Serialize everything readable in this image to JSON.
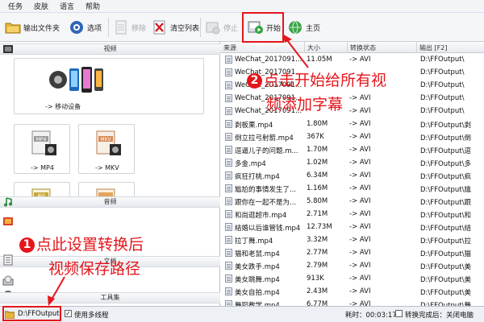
{
  "menu": [
    "任务",
    "皮肤",
    "语言",
    "帮助"
  ],
  "toolbar": {
    "output_folder": "输出文件夹",
    "options": "选项",
    "remove": "移除",
    "clear_list": "清空列表",
    "stop": "停止",
    "start": "开始",
    "home": "主页"
  },
  "left": {
    "video_section": "视频",
    "cards": [
      {
        "label": "-> 移动设备"
      },
      {
        "label": "-> MP4",
        "format": "MP4"
      },
      {
        "label": "-> MKV",
        "format": "MKV"
      },
      {
        "format": "AVI"
      },
      {}
    ],
    "audio_section": "音频",
    "doc_section": "文档",
    "toolbox_section": "工具集"
  },
  "list": {
    "columns": [
      "来源",
      "大小",
      "转换状态",
      "输出 [F2]"
    ],
    "rows": [
      {
        "name": "WeChat_2017091...",
        "size": "11.05M",
        "status": "-> AVI",
        "output": "D:\\FFOutput\\"
      },
      {
        "name": "WeChat_2017091...",
        "size": "",
        "status": "",
        "output": "D:\\FFOutput\\"
      },
      {
        "name": "WeChat_2017091...",
        "size": "",
        "status": "",
        "output": "D:\\FFOutput\\"
      },
      {
        "name": "WeChat_2017091...",
        "size": "",
        "status": "-> AVI",
        "output": "D:\\FFOutput\\"
      },
      {
        "name": "WeChat_2017091...",
        "size": "",
        "status": "-> AVI",
        "output": "D:\\FFOutput\\"
      },
      {
        "name": "剥板栗.mp4",
        "size": "1.80M",
        "status": "-> AVI",
        "output": "D:\\FFOutput\\剥"
      },
      {
        "name": "倒立拉弓射箭.mp4",
        "size": "367K",
        "status": "-> AVI",
        "output": "D:\\FFOutput\\倒"
      },
      {
        "name": "逗逼儿子的问题.m...",
        "size": "1.70M",
        "status": "-> AVI",
        "output": "D:\\FFOutput\\逗"
      },
      {
        "name": "多金.mp4",
        "size": "1.02M",
        "status": "-> AVI",
        "output": "D:\\FFOutput\\多"
      },
      {
        "name": "疯狂打桃.mp4",
        "size": "6.34M",
        "status": "-> AVI",
        "output": "D:\\FFOutput\\疯"
      },
      {
        "name": "尴尬的事情发生了...",
        "size": "1.16M",
        "status": "-> AVI",
        "output": "D:\\FFOutput\\尴"
      },
      {
        "name": "跟你在一起不是为...",
        "size": "5.80M",
        "status": "-> AVI",
        "output": "D:\\FFOutput\\跟"
      },
      {
        "name": "和尚逛超市.mp4",
        "size": "2.71M",
        "status": "-> AVI",
        "output": "D:\\FFOutput\\和"
      },
      {
        "name": "結婚以后谁管钱.mp4",
        "size": "12.73M",
        "status": "-> AVI",
        "output": "D:\\FFOutput\\结"
      },
      {
        "name": "拉丁舞.mp4",
        "size": "3.32M",
        "status": "-> AVI",
        "output": "D:\\FFOutput\\拉"
      },
      {
        "name": "猫和老鼠.mp4",
        "size": "2.77M",
        "status": "-> AVI",
        "output": "D:\\FFOutput\\猫"
      },
      {
        "name": "美女跌手.mp4",
        "size": "2.79M",
        "status": "-> AVI",
        "output": "D:\\FFOutput\\美"
      },
      {
        "name": "美女跳舞.mp4",
        "size": "913K",
        "status": "-> AVI",
        "output": "D:\\FFOutput\\美"
      },
      {
        "name": "美女自拍.mp4",
        "size": "2.43M",
        "status": "-> AVI",
        "output": "D:\\FFOutput\\美"
      },
      {
        "name": "舞蹈教学.mp4",
        "size": "6.77M",
        "status": "-> AVI",
        "output": "D:\\FFOutput\\舞"
      }
    ]
  },
  "status": {
    "path": "D:\\FFOutput",
    "multithread": "使用多线程",
    "elapsed_label": "耗时：00:03:17",
    "after_done": "转换完成后：关闭电脑"
  },
  "annotations": {
    "step1_number": "1",
    "step1_line1": "点此设置转换后",
    "step1_line2": "视频保存路径",
    "step2_number": "2",
    "step2_line1": "点击开始给所有视",
    "step2_line2": "频添加字幕"
  },
  "colors": {
    "accent_red": "#e4161c",
    "panel_blue": "#dfe6ef"
  }
}
